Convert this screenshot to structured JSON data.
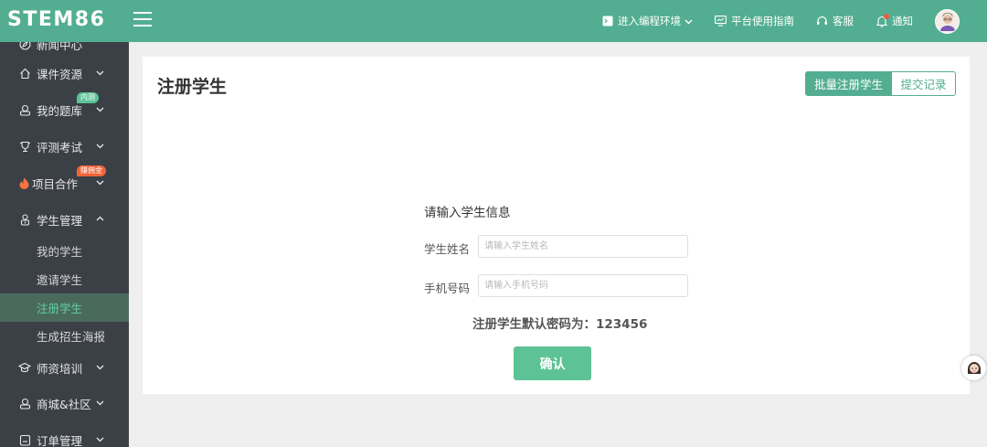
{
  "header": {
    "logo": "STEM86",
    "actions": [
      {
        "label": "进入编程环境",
        "icon": "terminal-icon"
      },
      {
        "label": "平台使用指南",
        "icon": "monitor-chart-icon"
      },
      {
        "label": "客服",
        "icon": "headset-icon"
      },
      {
        "label": "通知",
        "icon": "bell-icon"
      }
    ]
  },
  "sidebar": {
    "items": [
      {
        "label": "新闻中心"
      },
      {
        "label": "课件资源"
      },
      {
        "label": "我的题库",
        "badge": "内测"
      },
      {
        "label": "评测考试"
      },
      {
        "label": "项目合作",
        "badge": "赚佣金"
      },
      {
        "label": "学生管理"
      },
      {
        "label": "师资培训"
      },
      {
        "label": "商城&社区"
      },
      {
        "label": "订单管理"
      }
    ],
    "sub_items": [
      {
        "label": "我的学生"
      },
      {
        "label": "邀请学生"
      },
      {
        "label": "注册学生"
      },
      {
        "label": "生成招生海报"
      }
    ]
  },
  "main": {
    "title": "注册学生",
    "batch_button": "批量注册学生",
    "records_button": "提交记录",
    "form": {
      "title": "请输入学生信息",
      "name_label": "学生姓名",
      "name_placeholder": "请输入学生姓名",
      "phone_label": "手机号码",
      "phone_placeholder": "请输入手机号码",
      "password_note": "注册学生默认密码为：123456",
      "confirm_button": "确认"
    }
  },
  "colors": {
    "brand": "#53ae91",
    "sidebar_bg": "#3b4047",
    "confirm": "#5dc295",
    "badge_orange": "#f3643a"
  }
}
